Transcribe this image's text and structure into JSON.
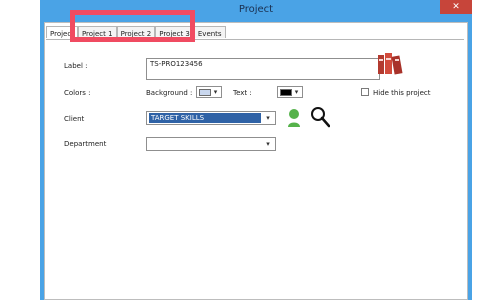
{
  "window": {
    "title": "Project",
    "close_icon": "✕"
  },
  "tabs": [
    {
      "label": "Project"
    },
    {
      "label": "Project 1"
    },
    {
      "label": "Project 2"
    },
    {
      "label": "Project 3"
    },
    {
      "label": "Events"
    }
  ],
  "form": {
    "label_label": "Label :",
    "label_value": "TS-PRO123456",
    "colors_label": "Colors :",
    "background_label": "Background :",
    "text_label": "Text :",
    "hide_label": "Hide this project",
    "client_label": "Client",
    "client_value": "TARGET SKILLS",
    "department_label": "Department"
  },
  "icons": {
    "books": "books-icon",
    "user": "user-icon",
    "search": "search-icon",
    "dropdown": "chevron-down-icon"
  },
  "colors": {
    "window_blue": "#4aa3e6",
    "close_red": "#c7453a",
    "highlight": "#f04b61",
    "client_blue": "#2f62a6",
    "user_green": "#55b24a",
    "books_red": "#c33b2f"
  }
}
